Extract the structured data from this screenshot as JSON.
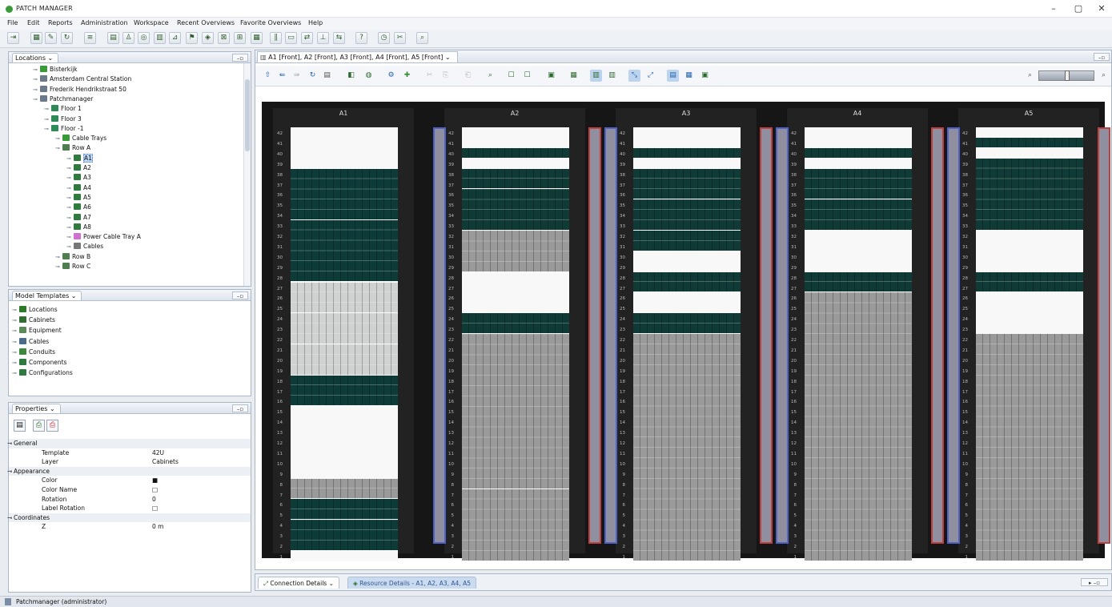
{
  "window": {
    "title": "PATCH MANAGER",
    "controls": [
      "–",
      "▢",
      "✕"
    ]
  },
  "menu": [
    "File",
    "Edit",
    "Reports",
    "Administration",
    "Workspace",
    "Recent Overviews",
    "Favorite Overviews",
    "Help"
  ],
  "locations_panel": {
    "title": "Locations",
    "items": [
      {
        "label": "Bisterkijk",
        "indent": 0,
        "icon": "green"
      },
      {
        "label": "Amsterdam Central Station",
        "indent": 0,
        "icon": "building"
      },
      {
        "label": "Frederik Hendrikstraat 50",
        "indent": 0,
        "icon": "building"
      },
      {
        "label": "Patchmanager",
        "indent": 0,
        "icon": "building"
      },
      {
        "label": "Floor 1",
        "indent": 1,
        "icon": "floor"
      },
      {
        "label": "Floor 3",
        "indent": 1,
        "icon": "floor"
      },
      {
        "label": "Floor -1",
        "indent": 1,
        "icon": "floor"
      },
      {
        "label": "Cable Trays",
        "indent": 2,
        "icon": "green"
      },
      {
        "label": "Row A",
        "indent": 2,
        "icon": "row"
      },
      {
        "label": "A1",
        "indent": 3,
        "icon": "rack",
        "selected": true
      },
      {
        "label": "A2",
        "indent": 3,
        "icon": "rack"
      },
      {
        "label": "A3",
        "indent": 3,
        "icon": "rack"
      },
      {
        "label": "A4",
        "indent": 3,
        "icon": "rack"
      },
      {
        "label": "A5",
        "indent": 3,
        "icon": "rack"
      },
      {
        "label": "A6",
        "indent": 3,
        "icon": "rack"
      },
      {
        "label": "A7",
        "indent": 3,
        "icon": "rack"
      },
      {
        "label": "A8",
        "indent": 3,
        "icon": "rack"
      },
      {
        "label": "Power Cable Tray A",
        "indent": 3,
        "icon": "pink"
      },
      {
        "label": "Cables",
        "indent": 3,
        "icon": "cable"
      },
      {
        "label": "Row B",
        "indent": 2,
        "icon": "row"
      },
      {
        "label": "Row C",
        "indent": 2,
        "icon": "row"
      }
    ]
  },
  "model_templates_panel": {
    "title": "Model Templates",
    "items": [
      "Locations",
      "Cabinets",
      "Equipment",
      "Cables",
      "Conduits",
      "Components",
      "Configurations"
    ]
  },
  "properties_panel": {
    "title": "Properties",
    "rows": [
      {
        "type": "cat",
        "label": "General"
      },
      {
        "key": "Template",
        "value": "42U"
      },
      {
        "key": "Layer",
        "value": "Cabinets"
      },
      {
        "type": "cat",
        "label": "Appearance"
      },
      {
        "key": "Color",
        "value": "■"
      },
      {
        "key": "Color Name",
        "value": "□"
      },
      {
        "key": "Rotation",
        "value": "0"
      },
      {
        "key": "Label Rotation",
        "value": "□"
      },
      {
        "type": "cat",
        "label": "Coordinates"
      },
      {
        "key": "Z",
        "value": "0 m"
      }
    ]
  },
  "editor": {
    "tab_label": "A1 [Front], A2 [Front], A3 [Front], A4 [Front], A5 [Front]",
    "racks": [
      "A1",
      "A2",
      "A3",
      "A4",
      "A5"
    ],
    "units": 42
  },
  "bottom_tabs": [
    "Connection Details",
    "Resource Details - A1, A2, A3, A4, A5"
  ],
  "status_text": "Patchmanager (administrator)"
}
